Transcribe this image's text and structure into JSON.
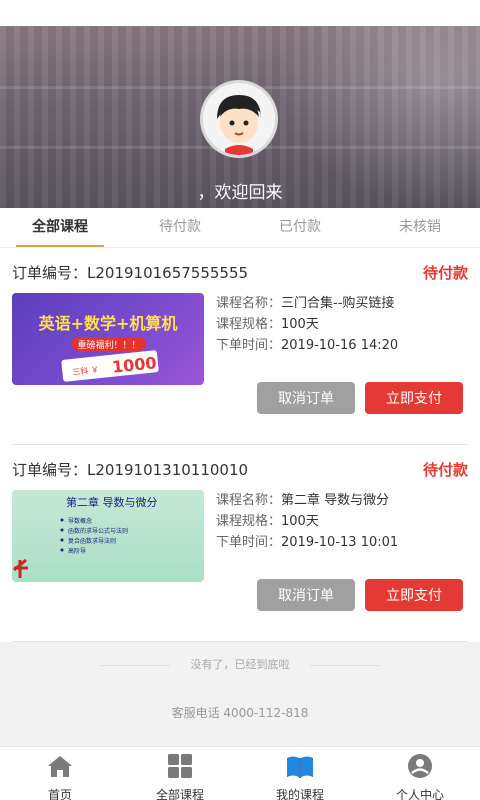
{
  "hero": {
    "welcome": "，欢迎回来"
  },
  "tabs": [
    {
      "label": "全部课程",
      "active": true
    },
    {
      "label": "待付款",
      "active": false
    },
    {
      "label": "已付款",
      "active": false
    },
    {
      "label": "未核销",
      "active": false
    }
  ],
  "orders": [
    {
      "order_no_label": "订单编号：L2019101657555555",
      "status": "待付款",
      "course_name": "三门合集--购买链接",
      "course_spec": "100天",
      "order_time": "2019-10-16 14:20",
      "thumb": {
        "title": "英语+数学+机算机",
        "sub": "重磅福利！！！",
        "price_prefix": "三科 ￥",
        "price": "1000"
      },
      "cancel_label": "取消订单",
      "pay_label": "立即支付"
    },
    {
      "order_no_label": "订单编号：L201910131011​0010",
      "status": "待付款",
      "course_name": "第二章 导数与微分",
      "course_spec": "100天",
      "order_time": "2019-10-13 10:01",
      "thumb": {
        "title": "第二章    导数与微分",
        "lines": [
          "导数概念",
          "函数的求导公式与法则",
          "复合函数求导法则",
          "高阶导"
        ]
      },
      "cancel_label": "取消订单",
      "pay_label": "立即支付"
    }
  ],
  "labels": {
    "course_name": "课程名称：",
    "course_spec": "课程规格：",
    "order_time": "下单时间："
  },
  "footer": {
    "end_note": "没有了，已经到底啦",
    "service_phone": "客服电话 4000-112-818"
  },
  "bottom_nav": [
    {
      "label": "首页",
      "icon": "home-icon"
    },
    {
      "label": "全部课程",
      "icon": "grid-icon"
    },
    {
      "label": "我的课程",
      "icon": "book-icon"
    },
    {
      "label": "个人中心",
      "icon": "user-icon"
    }
  ],
  "colors": {
    "accent": "#d8a94a",
    "status_red": "#e53935",
    "pay_red": "#e53935",
    "cancel_gray": "#a0a0a0",
    "nav_active": "#1e88e5"
  }
}
